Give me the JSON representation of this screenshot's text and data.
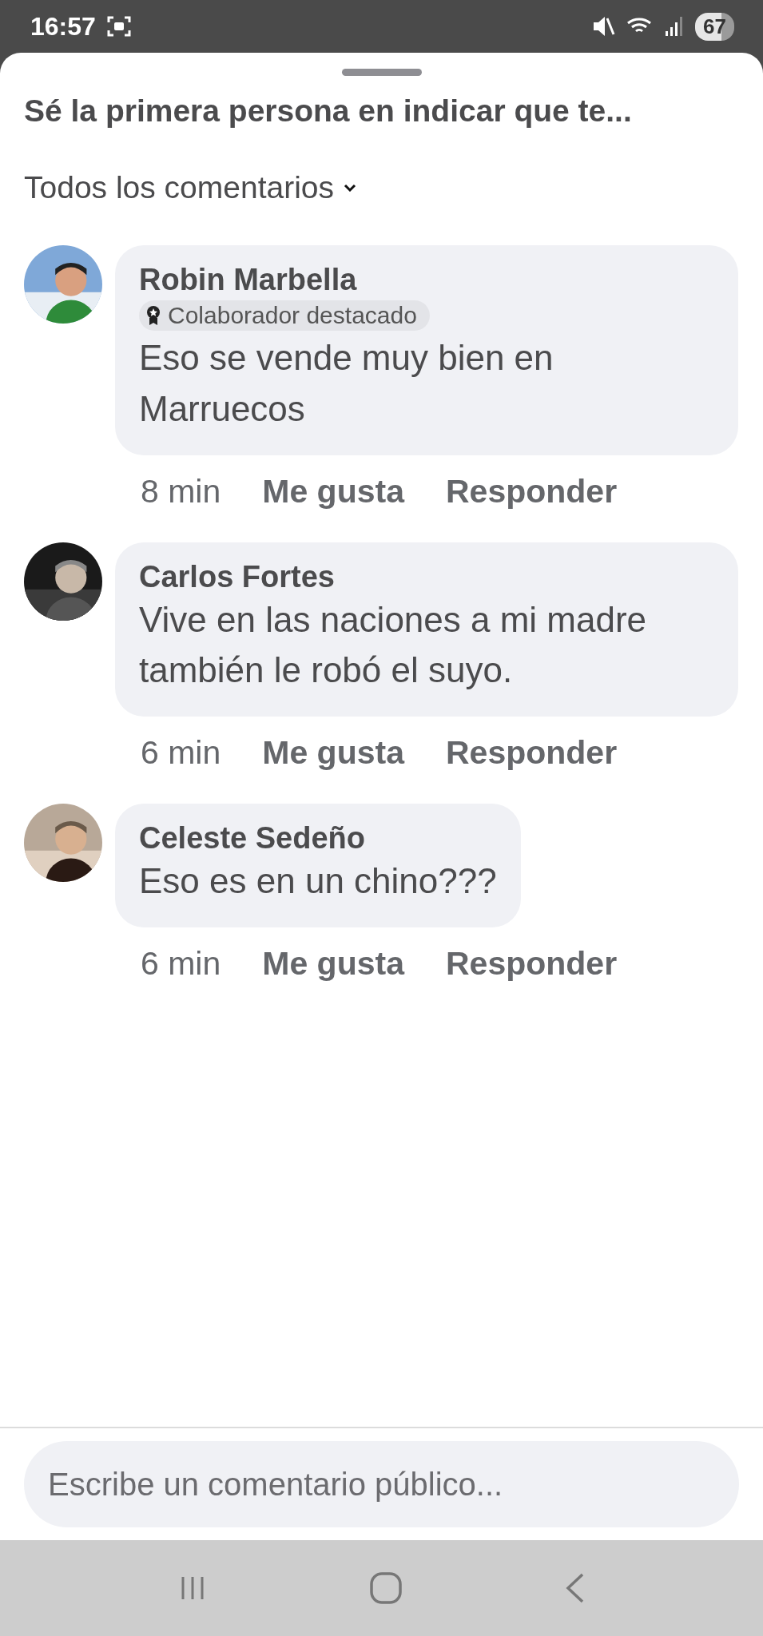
{
  "status_bar": {
    "time": "16:57",
    "battery": "67"
  },
  "sheet": {
    "title": "Sé la primera persona en indicar que te...",
    "filter": "Todos los comentarios"
  },
  "comments": [
    {
      "name": "Robin Marbella",
      "badge": "Colaborador destacado",
      "text": "Eso se vende muy bien en Marruecos",
      "time": "8 min",
      "like": "Me gusta",
      "reply": "Responder"
    },
    {
      "name": "Carlos Fortes",
      "text": "Vive en las naciones a mi madre también le robó el suyo.",
      "time": "6 min",
      "like": "Me gusta",
      "reply": "Responder"
    },
    {
      "name": "Celeste Sedeño",
      "text": "Eso es en un chino???",
      "time": "6 min",
      "like": "Me gusta",
      "reply": "Responder"
    }
  ],
  "composer": {
    "placeholder": "Escribe un comentario público..."
  }
}
